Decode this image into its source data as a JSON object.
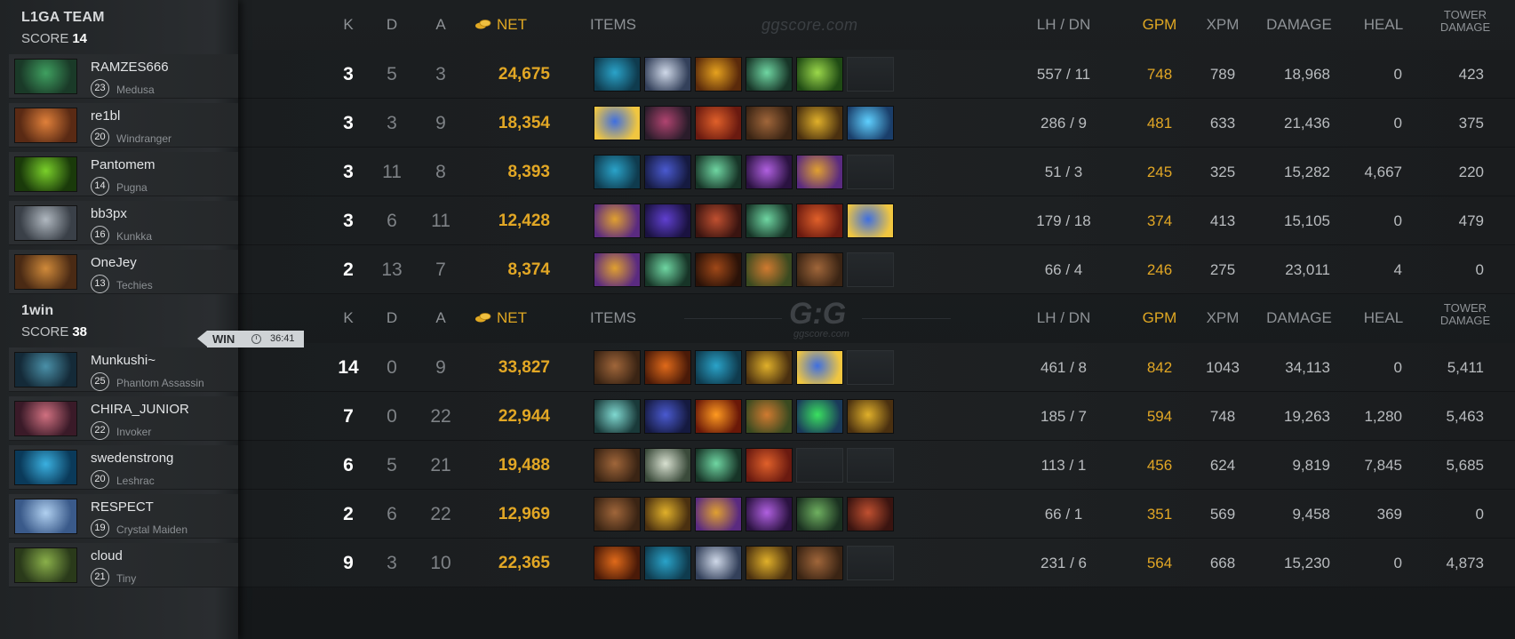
{
  "headers": {
    "k": "K",
    "d": "D",
    "a": "A",
    "net": "NET",
    "items": "ITEMS",
    "lhdn": "LH  /  DN",
    "gpm": "GPM",
    "xpm": "XPM",
    "damage": "DAMAGE",
    "heal": "HEAL",
    "tower_line1": "TOWER",
    "tower_line2": "DAMAGE"
  },
  "watermark": {
    "site": "ggscore.com",
    "logo": "G:G",
    "sub": "ggscore.com"
  },
  "win_badge": {
    "label": "WIN",
    "time": "36:41"
  },
  "colors": {
    "gold": "#e2a725",
    "background": "#17191b",
    "panel": "#2a2d30"
  },
  "teams": [
    {
      "name": "L1GA TEAM",
      "score_label": "SCORE",
      "score": "14",
      "players": [
        {
          "name": "RAMZES666",
          "level": "23",
          "hero": "Medusa",
          "portrait": "medusa-portrait",
          "k": "3",
          "d": "5",
          "a": "3",
          "net": "24,675",
          "items": [
            "helm-item",
            "claw-item",
            "scepter-item",
            "wand-item",
            "blade-item",
            "empty"
          ],
          "lhdn": "557  /  11",
          "gpm": "748",
          "xpm": "789",
          "damage": "18,968",
          "heal": "0",
          "tower": "423"
        },
        {
          "name": "re1bl",
          "level": "20",
          "hero": "Windranger",
          "portrait": "windranger-portrait",
          "k": "3",
          "d": "3",
          "a": "9",
          "net": "18,354",
          "items": [
            "staff-item",
            "scythe-item",
            "orb-item",
            "boots-item",
            "mask-item",
            "hammer-item"
          ],
          "lhdn": "286  /  9",
          "gpm": "481",
          "xpm": "633",
          "damage": "21,436",
          "heal": "0",
          "tower": "375"
        },
        {
          "name": "Pantomem",
          "level": "14",
          "hero": "Pugna",
          "portrait": "pugna-portrait",
          "k": "3",
          "d": "11",
          "a": "8",
          "net": "8,393",
          "items": [
            "helm-item",
            "cloak-item",
            "wand-item",
            "potion-item",
            "mango-item",
            "empty"
          ],
          "lhdn": "51  /  3",
          "gpm": "245",
          "xpm": "325",
          "damage": "15,282",
          "heal": "4,667",
          "tower": "220"
        },
        {
          "name": "bb3px",
          "level": "16",
          "hero": "Kunkka",
          "portrait": "kunkka-portrait",
          "k": "3",
          "d": "6",
          "a": "11",
          "net": "12,428",
          "items": [
            "mango-item",
            "helmet-item",
            "shield-item",
            "wand-item",
            "orb-item",
            "staff-item"
          ],
          "lhdn": "179  /  18",
          "gpm": "374",
          "xpm": "413",
          "damage": "15,105",
          "heal": "0",
          "tower": "479"
        },
        {
          "name": "OneJey",
          "level": "13",
          "hero": "Techies",
          "portrait": "techies-portrait",
          "k": "2",
          "d": "13",
          "a": "7",
          "net": "8,374",
          "items": [
            "mango-item",
            "wand-item",
            "cape-item",
            "lantern-item",
            "boots-item",
            "empty"
          ],
          "lhdn": "66  /  4",
          "gpm": "246",
          "xpm": "275",
          "damage": "23,011",
          "heal": "4",
          "tower": "0"
        }
      ]
    },
    {
      "name": "1win",
      "score_label": "SCORE",
      "score": "38",
      "players": [
        {
          "name": "Munkushi~",
          "level": "25",
          "hero": "Phantom Assassin",
          "portrait": "phantom-assassin-portrait",
          "k": "14",
          "d": "0",
          "a": "9",
          "net": "33,827",
          "items": [
            "boots-item",
            "axe-item",
            "helm-item",
            "mask-item",
            "staff-item",
            "empty"
          ],
          "lhdn": "461  /  8",
          "gpm": "842",
          "xpm": "1043",
          "damage": "34,113",
          "heal": "0",
          "tower": "5,411"
        },
        {
          "name": "CHIRA_JUNIOR",
          "level": "22",
          "hero": "Invoker",
          "portrait": "invoker-portrait",
          "k": "7",
          "d": "0",
          "a": "22",
          "net": "22,944",
          "items": [
            "dagger-item",
            "cloak-item",
            "fire-item",
            "lantern-item",
            "gem-item",
            "mask-item"
          ],
          "lhdn": "185  /  7",
          "gpm": "594",
          "xpm": "748",
          "damage": "19,263",
          "heal": "1,280",
          "tower": "5,463"
        },
        {
          "name": "swedenstrong",
          "level": "20",
          "hero": "Leshrac",
          "portrait": "leshrac-portrait",
          "k": "6",
          "d": "5",
          "a": "21",
          "net": "19,488",
          "items": [
            "boots-item",
            "bow-item",
            "wand-item",
            "orb-item",
            "empty",
            "empty"
          ],
          "lhdn": "113  /  1",
          "gpm": "456",
          "xpm": "624",
          "damage": "9,819",
          "heal": "7,845",
          "tower": "5,685"
        },
        {
          "name": "RESPECT",
          "level": "19",
          "hero": "Crystal Maiden",
          "portrait": "crystal-maiden-portrait",
          "k": "2",
          "d": "6",
          "a": "22",
          "net": "12,969",
          "items": [
            "boots-item",
            "mask-item",
            "mango-item",
            "potion-item",
            "spear-item",
            "shield-item"
          ],
          "lhdn": "66  /  1",
          "gpm": "351",
          "xpm": "569",
          "damage": "9,458",
          "heal": "369",
          "tower": "0"
        },
        {
          "name": "cloud",
          "level": "21",
          "hero": "Tiny",
          "portrait": "tiny-portrait",
          "k": "9",
          "d": "3",
          "a": "10",
          "net": "22,365",
          "items": [
            "axe-item",
            "helm-item",
            "claw-item",
            "mask-item",
            "boots-item",
            "empty"
          ],
          "lhdn": "231  /  6",
          "gpm": "564",
          "xpm": "668",
          "damage": "15,230",
          "heal": "0",
          "tower": "4,873"
        }
      ]
    }
  ]
}
